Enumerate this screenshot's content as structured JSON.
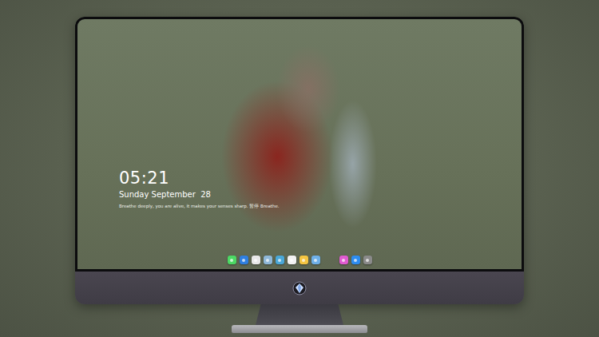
{
  "desktop": {
    "clock": {
      "time": "05:21",
      "date": "Sunday September  28",
      "note": "Breathe deeply, you are alive, it makes your senses sharp. 暂停 Breathe."
    }
  },
  "dock": {
    "items": [
      {
        "kind": "app",
        "color": "#4cd964"
      },
      {
        "kind": "app",
        "color": "#2f7fe0"
      },
      {
        "kind": "app",
        "color": "#e8e8e8"
      },
      {
        "kind": "app",
        "color": "#8fb8d8"
      },
      {
        "kind": "app",
        "color": "#4aa8d8"
      },
      {
        "kind": "app",
        "color": "#f2f2f2"
      },
      {
        "kind": "app",
        "color": "#f4c542"
      },
      {
        "kind": "app",
        "color": "#6fb0e8"
      },
      {
        "kind": "gap",
        "color": "#000000"
      },
      {
        "kind": "app",
        "color": "#e05bd0"
      },
      {
        "kind": "app",
        "color": "#2d8cf0"
      },
      {
        "kind": "app",
        "color": "#8a8a8a"
      }
    ]
  }
}
